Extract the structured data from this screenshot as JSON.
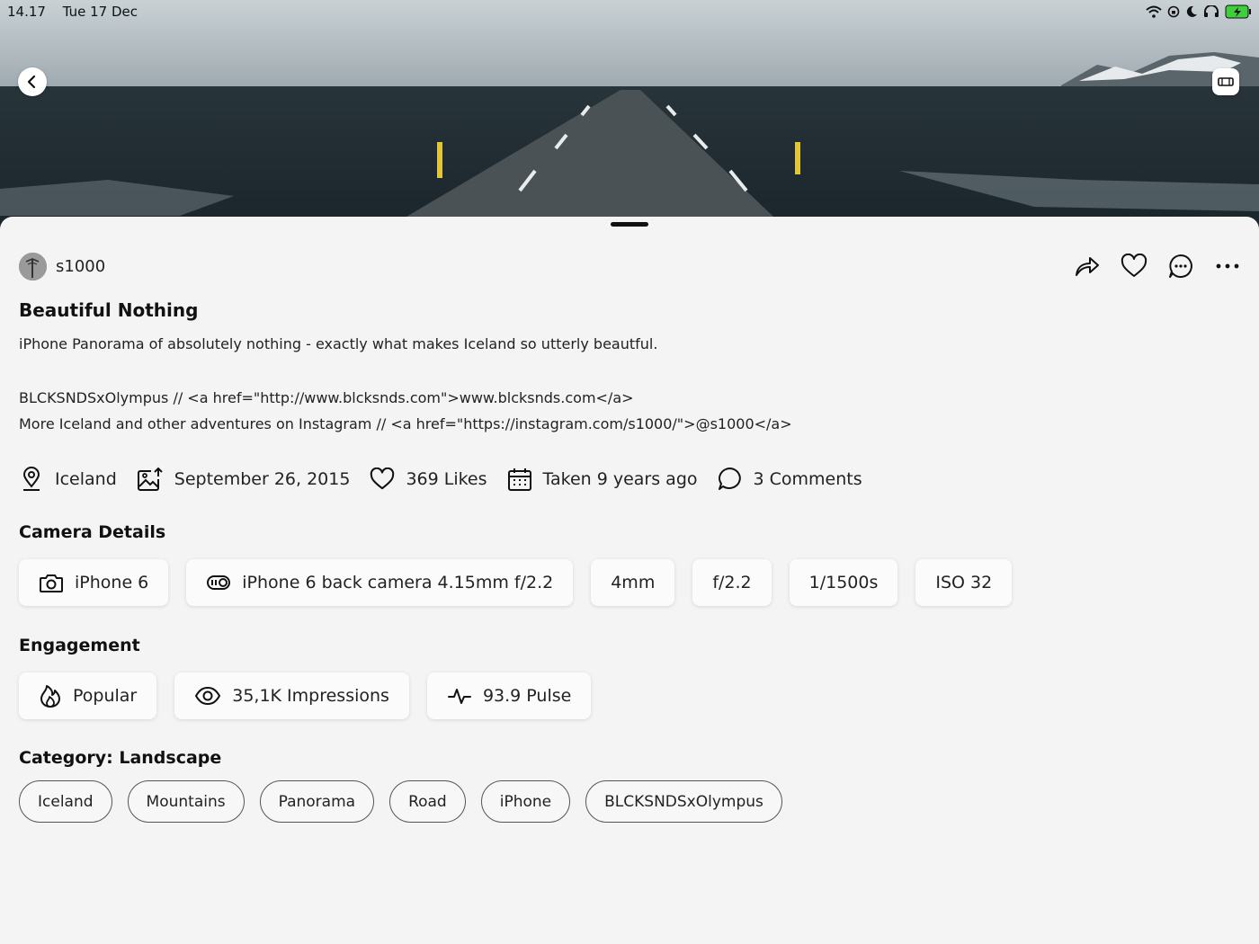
{
  "status_bar": {
    "time": "14.17",
    "date": "Tue 17 Dec",
    "icons": [
      "wifi-icon",
      "lock-rotation-icon",
      "moon-icon",
      "headphones-icon",
      "battery-charging-icon"
    ]
  },
  "hero": {
    "back_icon": "chevron-left-icon",
    "panorama_icon": "panorama-icon"
  },
  "author": {
    "username": "s1000"
  },
  "actions": [
    "share-icon",
    "heart-icon",
    "comment-icon",
    "more-icon"
  ],
  "photo": {
    "title": "Beautiful Nothing",
    "description_1": "iPhone Panorama of absolutely nothing - exactly what makes Iceland so utterly beautful.",
    "description_2": "BLCKSNDSxOlympus // <a href=\"http://www.blcksnds.com\">www.blcksnds.com</a>",
    "description_3": "More Iceland and other adventures on Instagram // <a href=\"https://instagram.com/s1000/\">@s1000</a>"
  },
  "meta": {
    "location": "Iceland",
    "date": "September 26, 2015",
    "likes": "369 Likes",
    "taken": "Taken 9 years ago",
    "comments": "3 Comments"
  },
  "camera": {
    "title": "Camera Details",
    "device": "iPhone 6",
    "lens": "iPhone 6 back camera 4.15mm f/2.2",
    "focal": "4mm",
    "aperture": "f/2.2",
    "shutter": "1/1500s",
    "iso": "ISO 32"
  },
  "engagement": {
    "title": "Engagement",
    "popular": "Popular",
    "impressions": "35,1K Impressions",
    "pulse": "93.9 Pulse"
  },
  "category": {
    "title": "Category: Landscape",
    "tags": [
      "Iceland",
      "Mountains",
      "Panorama",
      "Road",
      "iPhone",
      "BLCKSNDSxOlympus"
    ]
  }
}
